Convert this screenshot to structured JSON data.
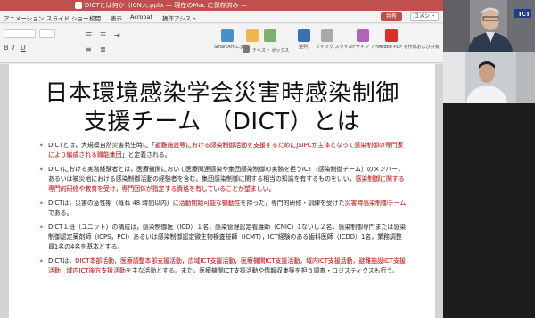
{
  "window": {
    "title": "DICTとは何か（ICN入.pptx — 現在のMac に保存済み —"
  },
  "menu": {
    "items": [
      "アニメーション",
      "スライド ショー",
      "校閲",
      "表示",
      "Acrobat",
      "操作アシスト"
    ],
    "share_label": "共有",
    "comment_label": "コメント"
  },
  "ribbon": {
    "smartart_label": "SmartArt に変換",
    "textbox_label": "テキスト ボックス",
    "arrange_label": "整列",
    "quickstyle_label": "クイック スタイル",
    "designer_label": "デザイン アイデア",
    "acrobat_label": "Adobe PDF を作成および共有"
  },
  "slide": {
    "title_line1": "日本環境感染学会災害時感染制御",
    "title_line2": "支援チーム （DICT）とは",
    "bullets": [
      {
        "segments": [
          {
            "text": "DICTとは，大規模自然災害発生時に「",
            "red": false
          },
          {
            "text": "避難施設等における感染制御活動を支援するためにJSIPCが主体となって感染制御の専門家により編成される職能集団",
            "red": true
          },
          {
            "text": "」と定義される。",
            "red": false
          }
        ]
      },
      {
        "segments": [
          {
            "text": "DICTにおける実務経験者とは，医療機関において医療関連感染や集団感染制御の実務を担うICT（感染制御チーム）のメンバー，あるいは被災地における感染制御活動の経験者を含む。集団感染制御に関する相当の知識を有するものをいい，",
            "red": false
          },
          {
            "text": "感染制御に関する専門的研修や教育を受け，専門団体が指定する資格を有していることが望ましい",
            "red": true
          },
          {
            "text": "。",
            "red": false
          }
        ]
      },
      {
        "segments": [
          {
            "text": "DICTは，災害の急性期（概ね 48 時間以内）",
            "red": false
          },
          {
            "text": "に活動開始可能な機動性",
            "red": true
          },
          {
            "text": "を持った，専門的研修・訓練を受けた",
            "red": false
          },
          {
            "text": "災害時感染制御チーム",
            "red": true
          },
          {
            "text": "である。",
            "red": false
          }
        ]
      },
      {
        "segments": [
          {
            "text": "DICT１班（ユニット）の構成は，感染制御医（ICD）１名，感染管理認定看護師（CNIC）1ないし２名，感染制御専門または感染制御認定薬剤師（ICPS，PCI）あるいは感染制御認定微生物検査技師（ICMT），ICT経験のある歯科医師（ICDD）1名，業務調整員1名の4名を基本とする。",
            "red": false
          }
        ]
      },
      {
        "segments": [
          {
            "text": "DICTは，",
            "red": false
          },
          {
            "text": "DICT本部活動，医療調整本部支援活動，広域ICT支援活動，医療機関ICT支援活動，域内ICT支援活動，避難施設ICT支援活動，域内ICT後方支援活動",
            "red": true
          },
          {
            "text": "を主な活動とする。また，医療機関ICT支援活動や情報収集等を担う調査・ロジスティクスも行う。",
            "red": false
          }
        ]
      }
    ]
  },
  "video": {
    "logo_text": "ICT"
  }
}
